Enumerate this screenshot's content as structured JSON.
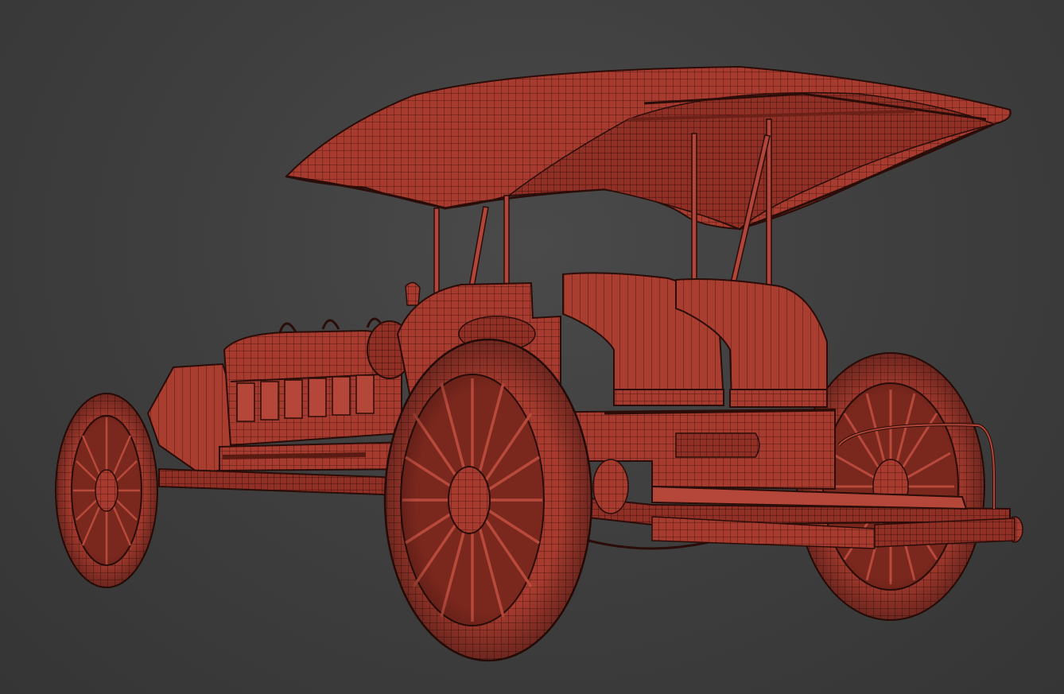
{
  "viewport": {
    "background_color": "#3d3d3d",
    "model_color": "#a63a2e",
    "wire_color": "#2a0d08",
    "subject": "vintage-race-car-wireframe-model"
  }
}
